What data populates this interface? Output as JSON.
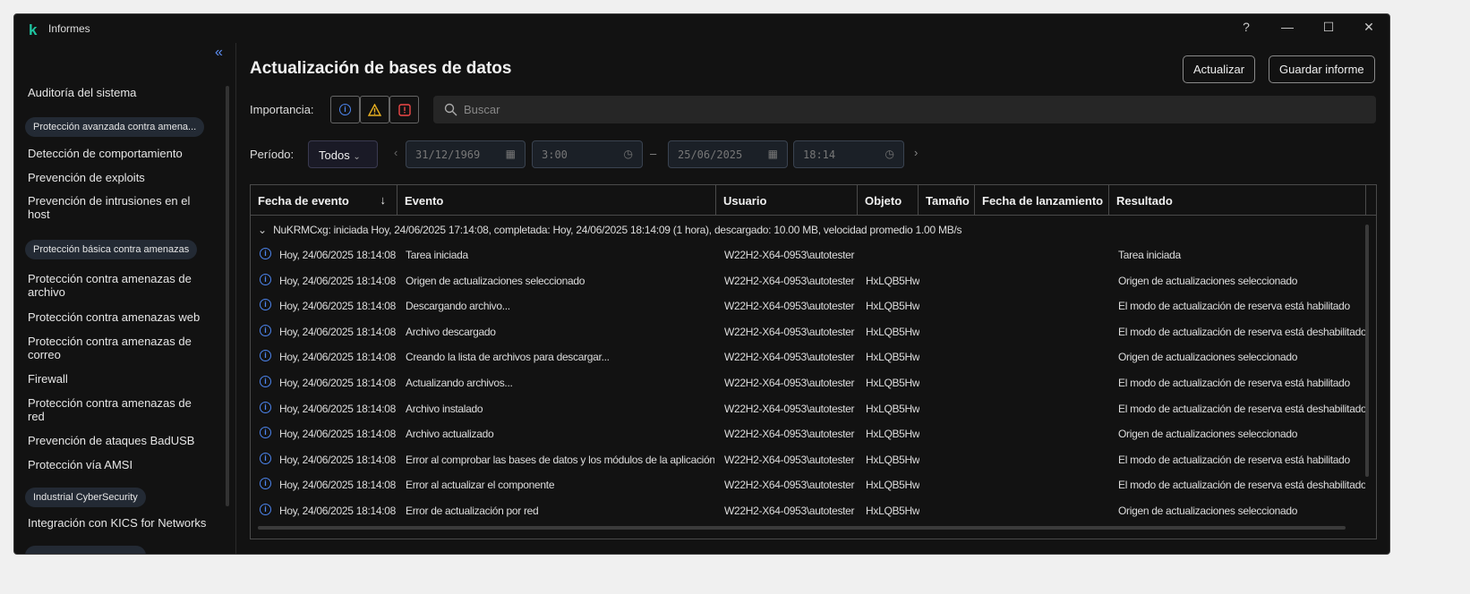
{
  "window": {
    "title": "Informes",
    "help": "?",
    "minimize": "—",
    "maximize": "☐",
    "close": "✕",
    "logo": "k"
  },
  "sidebar": {
    "collapse": "«",
    "items": [
      {
        "type": "item",
        "label": "Auditoría del sistema"
      },
      {
        "type": "group",
        "label": "Protección avanzada contra amena..."
      },
      {
        "type": "item",
        "label": "Detección de comportamiento"
      },
      {
        "type": "item",
        "label": "Prevención de exploits"
      },
      {
        "type": "item",
        "label": "Prevención de intrusiones en el host"
      },
      {
        "type": "group",
        "label": "Protección básica contra amenazas"
      },
      {
        "type": "item",
        "label": "Protección contra amenazas de archivo"
      },
      {
        "type": "item",
        "label": "Protección contra amenazas web"
      },
      {
        "type": "item",
        "label": "Protección contra amenazas de correo"
      },
      {
        "type": "item",
        "label": "Firewall"
      },
      {
        "type": "item",
        "label": "Protección contra amenazas de red"
      },
      {
        "type": "item",
        "label": "Prevención de ataques BadUSB"
      },
      {
        "type": "item",
        "label": "Protección vía AMSI"
      },
      {
        "type": "group",
        "label": "Industrial CyberSecurity"
      },
      {
        "type": "item",
        "label": "Integración con KICS for Networks"
      }
    ]
  },
  "main": {
    "title": "Actualización de bases de datos",
    "refresh": "Actualizar",
    "save": "Guardar informe",
    "importance_label": "Importancia:",
    "search_placeholder": "Buscar",
    "period_label": "Período:",
    "period": "Todos",
    "from_date": "31/12/1969",
    "from_time": "3:00",
    "dash": "–",
    "to_date": "25/06/2025",
    "to_time": "18:14"
  },
  "table": {
    "columns": [
      "Fecha de evento",
      "Evento",
      "Usuario",
      "Objeto",
      "Tamaño",
      "Fecha de lanzamiento",
      "Resultado"
    ],
    "sort_icon": "↓",
    "group": "NuKRMCxg: iniciada Hoy, 24/06/2025 17:14:08, completada: Hoy, 24/06/2025 18:14:09 (1 hora), descargado: 10.00 MB, velocidad promedio 1.00 MB/s",
    "rows": [
      {
        "date": "Hoy, 24/06/2025 18:14:08",
        "event": "Tarea iniciada",
        "user": "W22H2-X64-0953\\autotester",
        "object": "",
        "result": "Tarea iniciada"
      },
      {
        "date": "Hoy, 24/06/2025 18:14:08",
        "event": "Origen de actualizaciones seleccionado",
        "user": "W22H2-X64-0953\\autotester",
        "object": "HxLQB5Hw",
        "result": "Origen de actualizaciones seleccionado"
      },
      {
        "date": "Hoy, 24/06/2025 18:14:08",
        "event": "Descargando archivo...",
        "user": "W22H2-X64-0953\\autotester",
        "object": "HxLQB5Hw",
        "result": "El modo de actualización de reserva está habilitado"
      },
      {
        "date": "Hoy, 24/06/2025 18:14:08",
        "event": "Archivo descargado",
        "user": "W22H2-X64-0953\\autotester",
        "object": "HxLQB5Hw",
        "result": "El modo de actualización de reserva está deshabilitado"
      },
      {
        "date": "Hoy, 24/06/2025 18:14:08",
        "event": "Creando la lista de archivos para descargar...",
        "user": "W22H2-X64-0953\\autotester",
        "object": "HxLQB5Hw",
        "result": "Origen de actualizaciones seleccionado"
      },
      {
        "date": "Hoy, 24/06/2025 18:14:08",
        "event": "Actualizando archivos...",
        "user": "W22H2-X64-0953\\autotester",
        "object": "HxLQB5Hw",
        "result": "El modo de actualización de reserva está habilitado"
      },
      {
        "date": "Hoy, 24/06/2025 18:14:08",
        "event": "Archivo instalado",
        "user": "W22H2-X64-0953\\autotester",
        "object": "HxLQB5Hw",
        "result": "El modo de actualización de reserva está deshabilitado"
      },
      {
        "date": "Hoy, 24/06/2025 18:14:08",
        "event": "Archivo actualizado",
        "user": "W22H2-X64-0953\\autotester",
        "object": "HxLQB5Hw",
        "result": "Origen de actualizaciones seleccionado"
      },
      {
        "date": "Hoy, 24/06/2025 18:14:08",
        "event": "Error al comprobar las bases de datos y los módulos de la aplicación",
        "user": "W22H2-X64-0953\\autotester",
        "object": "HxLQB5Hw",
        "result": "El modo de actualización de reserva está habilitado"
      },
      {
        "date": "Hoy, 24/06/2025 18:14:08",
        "event": "Error al actualizar el componente",
        "user": "W22H2-X64-0953\\autotester",
        "object": "HxLQB5Hw",
        "result": "El modo de actualización de reserva está deshabilitado"
      },
      {
        "date": "Hoy, 24/06/2025 18:14:08",
        "event": "Error de actualización por red",
        "user": "W22H2-X64-0953\\autotester",
        "object": "HxLQB5Hw",
        "result": "Origen de actualizaciones seleccionado"
      }
    ]
  }
}
